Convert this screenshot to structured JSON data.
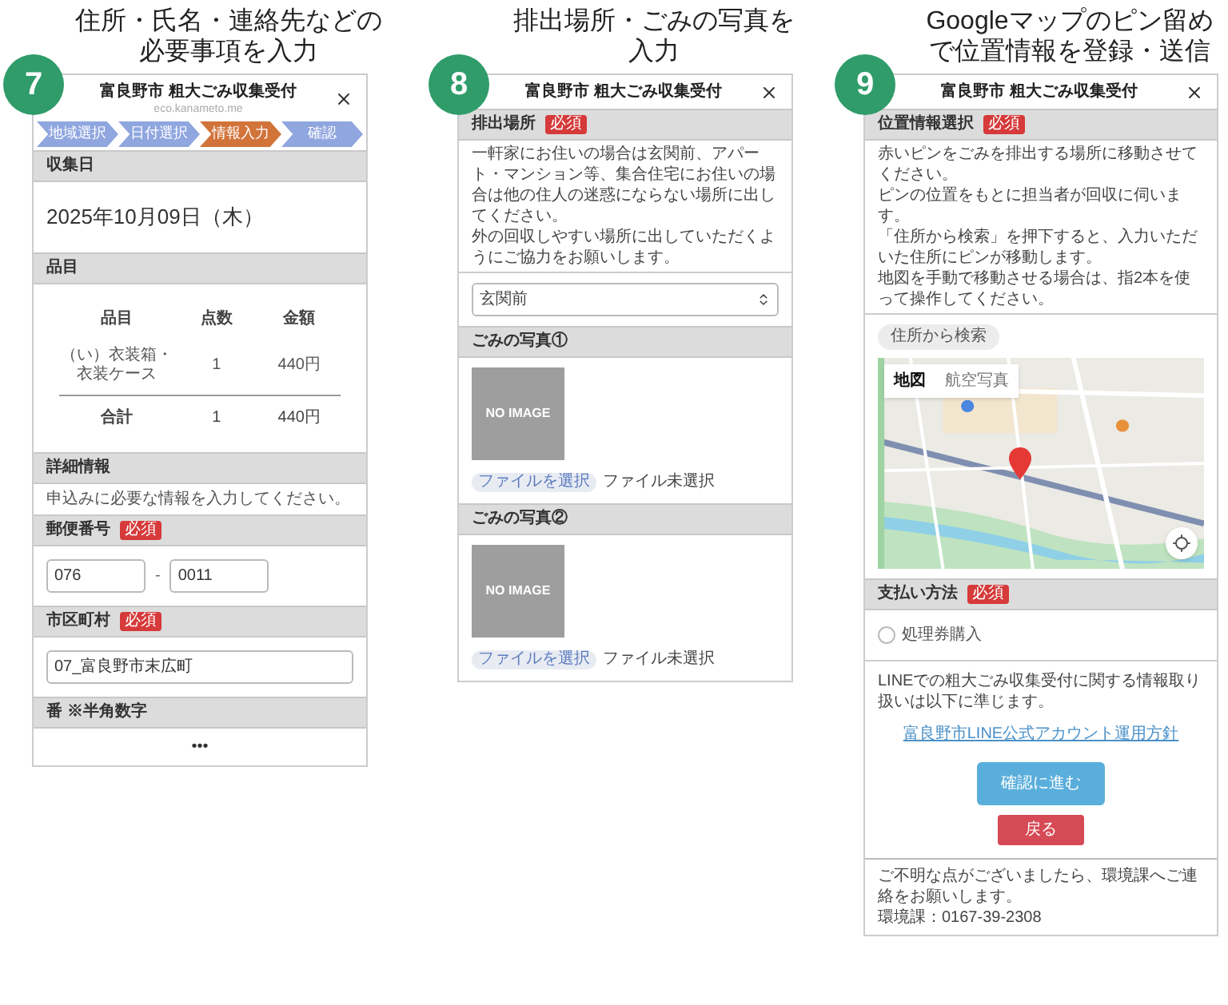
{
  "steps": [
    {
      "number": "7",
      "heading_lines": [
        "住所・氏名・連絡先などの",
        "必要事項を入力"
      ],
      "screen": {
        "title": "富良野市 粗大ごみ収集受付",
        "subtitle": "eco.kanameto.me",
        "progress": [
          {
            "label": "地域選択",
            "selected": false
          },
          {
            "label": "日付選択",
            "selected": false
          },
          {
            "label": "情報入力",
            "selected": true
          },
          {
            "label": "確認",
            "selected": false
          }
        ],
        "sections": [
          {
            "kind": "date",
            "label": "収集日",
            "value": "2025年10月09日（木）"
          },
          {
            "kind": "table",
            "label": "品目",
            "columns": [
              "品目",
              "点数",
              "金額"
            ],
            "rows": [
              [
                "（い）衣装箱・衣装ケース",
                "1",
                "440円"
              ]
            ],
            "total": [
              "合計",
              "1",
              "440円"
            ]
          },
          {
            "kind": "note",
            "label": "詳細情報",
            "text": "申込みに必要な情報を入力してください。"
          },
          {
            "kind": "postal",
            "label": "郵便番号",
            "badge": "必須",
            "values": [
              "076",
              "0011"
            ],
            "separator": "-"
          },
          {
            "kind": "input",
            "label": "市区町村",
            "badge": "必須",
            "value": "07_富良野市末広町"
          },
          {
            "kind": "more",
            "label": "番 ※半角数字",
            "text": "•••"
          }
        ]
      }
    },
    {
      "number": "8",
      "heading_lines": [
        "排出場所・ごみの写真を",
        "入力"
      ],
      "screen": {
        "title": "富良野市 粗大ごみ収集受付",
        "sections": [
          {
            "kind": "select",
            "label": "排出場所",
            "badge": "必須",
            "paragraphs": [
              "一軒家にお住いの場合は玄関前、アパート・マンション等、集合住宅にお住いの場合は他の住人の迷惑にならない場所に出してください。",
              "外の回収しやすい場所に出していただくようにご協力をお願いします。"
            ],
            "chosen_option": "玄関前"
          },
          {
            "label": "ごみの写真①",
            "image_text": "NO IMAGE",
            "button": "ファイルを選択",
            "status": "ファイル未選択"
          },
          {
            "label": "ごみの写真②",
            "image_text": "NO IMAGE",
            "button": "ファイルを選択",
            "status": "ファイル未選択"
          }
        ]
      }
    },
    {
      "number": "9",
      "heading_lines": [
        "Googleマップのピン留め",
        "で位置情報を登録・送信"
      ],
      "screen": {
        "title": "富良野市 粗大ごみ収集受付",
        "sections": [
          {
            "kind": "map",
            "label": "位置情報選択",
            "badge": "必須",
            "paragraphs": [
              "赤いピンをごみを排出する場所に移動させてください。",
              "ピンの位置をもとに担当者が回収に伺います。",
              "「住所から検索」を押下すると、入力いただいた住所にピンが移動します。",
              "地図を手動で移動させる場合は、指2本を使って操作してください。"
            ],
            "search_button": "住所から検索",
            "map_types": [
              {
                "label": "地図",
                "selected": true
              },
              {
                "label": "航空写真",
                "selected": false
              }
            ]
          },
          {
            "kind": "radio",
            "label": "支払い方法",
            "badge": "必須",
            "options": [
              {
                "label": "処理券購入",
                "selected": false
              }
            ]
          },
          {
            "kind": "footer",
            "text": "LINEでの粗大ごみ収集受付に関する情報取り扱いは以下に準じます。",
            "link": "富良野市LINE公式アカウント運用方針",
            "primary": "確認に進む",
            "secondary": "戻る"
          },
          {
            "kind": "contact",
            "paragraphs": [
              "ご不明な点がございましたら、環境課へご連絡をお願いします。",
              "環境課：0167-39-2308"
            ]
          }
        ]
      }
    }
  ]
}
